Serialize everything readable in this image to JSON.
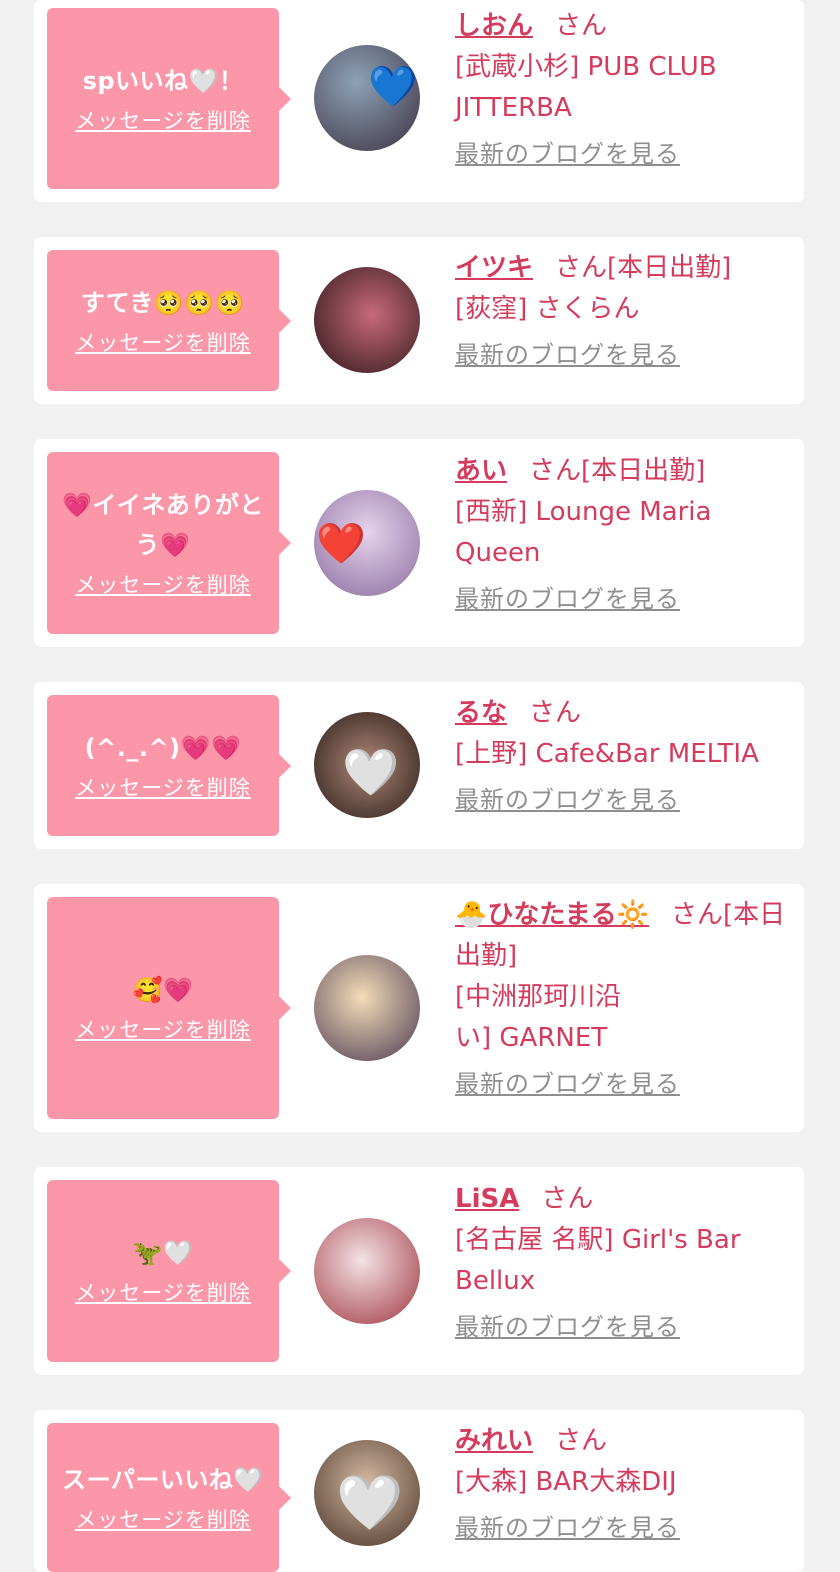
{
  "entries": [
    {
      "message": "spいいね🤍！",
      "delete_label": "メッセージを削除",
      "name": "しおん",
      "suffix": "さん",
      "shop": "[武蔵小杉] PUB CLUB JITTERBA",
      "blog_label": "最新のブログを見る",
      "avatar_colors": [
        "#8da2b8",
        "#3d3140"
      ],
      "avatar_mark": "💙"
    },
    {
      "message": "すてき🥺🥺🥺",
      "delete_label": "メッセージを削除",
      "name": "イツキ",
      "suffix": "さん[本日出勤]",
      "shop": "[荻窪] さくらん",
      "blog_label": "最新のブログを見る",
      "avatar_colors": [
        "#7a2a2e",
        "#2b1518"
      ],
      "avatar_mark": ""
    },
    {
      "message": "💗イイネありがとう💗",
      "delete_label": "メッセージを削除",
      "name": "あい",
      "suffix": "さん[本日出勤]",
      "shop": "[西新] Lounge Maria Queen",
      "blog_label": "最新のブログを見る",
      "avatar_colors": [
        "#c9a8d8",
        "#8a6e9e"
      ],
      "avatar_mark": "❤️"
    },
    {
      "message": "(^._.^)💗💗",
      "delete_label": "メッセージを削除",
      "name": "るな",
      "suffix": "さん",
      "shop": "[上野] Cafe&Bar MELTIA",
      "blog_label": "最新のブログを見る",
      "avatar_colors": [
        "#6b4a3a",
        "#2a1c16"
      ],
      "avatar_mark": "🤍"
    },
    {
      "message": "🥰💗",
      "delete_label": "メッセージを削除",
      "name": "🐣ひなたまる🔆",
      "suffix": "さん[本日出勤]",
      "shop": "[中洲那珂川沿い] GARNET",
      "blog_label": "最新のブログを見る",
      "avatar_colors": [
        "#f0c48a",
        "#4a3a52"
      ],
      "avatar_mark": ""
    },
    {
      "message": "🦖🤍",
      "delete_label": "メッセージを削除",
      "name": "LiSA",
      "suffix": "さん",
      "shop": "[名古屋 名駅] Girl's Bar Bellux",
      "blog_label": "最新のブログを見る",
      "avatar_colors": [
        "#e8c3c8",
        "#a0363f"
      ],
      "avatar_mark": ""
    },
    {
      "message": "スーパーいいね🤍",
      "delete_label": "メッセージを削除",
      "name": "みれい",
      "suffix": "さん",
      "shop": "[大森] BAR大森DIJ",
      "blog_label": "最新のブログを見る",
      "avatar_colors": [
        "#9a7c66",
        "#4a3428"
      ],
      "avatar_mark": "🤍"
    }
  ],
  "colors": {
    "background": "#f2f1f1",
    "card": "#ffffff",
    "bubble": "#fc97a9",
    "accent_text": "#d43b5c",
    "link_gray": "#8f8f8f"
  }
}
